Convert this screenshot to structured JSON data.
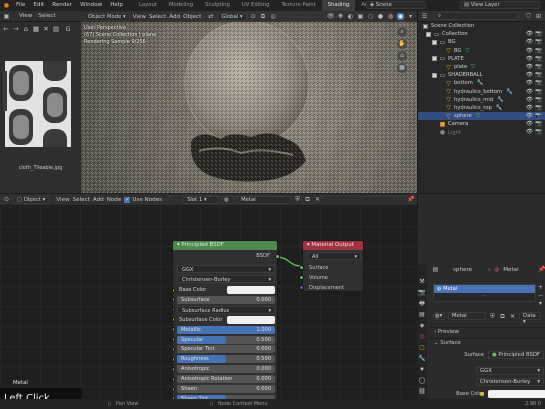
{
  "topbar": {
    "menus": [
      "File",
      "Edit",
      "Render",
      "Window",
      "Help"
    ],
    "workspaces": [
      "Layout",
      "Modeling",
      "Sculpting",
      "UV Editing",
      "Texture Paint",
      "Shading",
      "Animation",
      "Rend"
    ],
    "active_workspace": "Shading",
    "scene": "Scene",
    "view_layer": "View Layer"
  },
  "image_editor": {
    "menus": [
      "View",
      "Select"
    ],
    "image_name": "cloth_Tileable.jpg"
  },
  "viewport": {
    "mode": "Object Mode",
    "menus": [
      "View",
      "Select",
      "Add",
      "Object"
    ],
    "orientation": "Global",
    "info_lines": [
      "User Perspective",
      "(67) Scene Collection | plane",
      "Rendering Sample 9/256"
    ]
  },
  "outliner": {
    "root": "Scene Collection",
    "rows": [
      {
        "label": "Collection",
        "depth": 1,
        "kind": "collection"
      },
      {
        "label": "BG",
        "depth": 2,
        "kind": "collection"
      },
      {
        "label": "BG",
        "depth": 3,
        "kind": "mesh"
      },
      {
        "label": "PLATE",
        "depth": 2,
        "kind": "collection"
      },
      {
        "label": "plate",
        "depth": 3,
        "kind": "mesh"
      },
      {
        "label": "SHADERBALL",
        "depth": 2,
        "kind": "collection"
      },
      {
        "label": "bottom",
        "depth": 3,
        "kind": "mesh"
      },
      {
        "label": "hydraulics_bottom",
        "depth": 3,
        "kind": "mesh"
      },
      {
        "label": "hydraulics_mid",
        "depth": 3,
        "kind": "mesh"
      },
      {
        "label": "hydraulics_top",
        "depth": 3,
        "kind": "mesh"
      },
      {
        "label": "sphere",
        "depth": 3,
        "kind": "mesh",
        "selected": true
      },
      {
        "label": "Camera",
        "depth": 2,
        "kind": "camera"
      },
      {
        "label": "Light",
        "depth": 2,
        "kind": "light",
        "dim": true
      }
    ]
  },
  "node_editor": {
    "mode": "Object",
    "menus": [
      "View",
      "Select",
      "Add",
      "Node"
    ],
    "use_nodes": "Use Nodes",
    "slot": "Slot 1",
    "material": "Metal",
    "material_label": "Metal",
    "principled": {
      "title": "Principled BSDF",
      "output": "BSDF",
      "distribution": "GGX",
      "subsurface_method": "Christensen-Burley",
      "fields": [
        {
          "name": "Base Color",
          "kind": "color",
          "color": "#f0f0f0"
        },
        {
          "name": "Subsurface",
          "value": "0.000",
          "fill": 0
        },
        {
          "name": "Subsurface Radius",
          "kind": "dropdown"
        },
        {
          "name": "Subsurface Color",
          "kind": "color",
          "color": "#f0f0f0"
        },
        {
          "name": "Metallic",
          "value": "1.000",
          "fill": 1
        },
        {
          "name": "Specular",
          "value": "0.500",
          "fill": 0.5
        },
        {
          "name": "Specular Tint",
          "value": "0.000",
          "fill": 0
        },
        {
          "name": "Roughness",
          "value": "0.500",
          "fill": 0.5
        },
        {
          "name": "Anisotropic",
          "value": "0.000",
          "fill": 0
        },
        {
          "name": "Anisotropic Rotation",
          "value": "0.000",
          "fill": 0
        },
        {
          "name": "Sheen",
          "value": "0.000",
          "fill": 0
        },
        {
          "name": "Sheen Tint",
          "value": "",
          "fill": 0.5
        }
      ]
    },
    "material_output": {
      "title": "Material Output",
      "target": "All",
      "inputs": [
        "Surface",
        "Volume",
        "Displacement"
      ]
    }
  },
  "properties": {
    "object": "sphere",
    "material_tab": "Metal",
    "slot_name": "Metal",
    "material_name": "Metal",
    "data_label": "Data",
    "preview": "Preview",
    "surface_section": "Surface",
    "surface_label": "Surface",
    "surface_value": "Principled BSDF",
    "distribution": "GGX",
    "subsurface_method": "Christensen-Burley",
    "base_color_label": "Base Color",
    "base_color": "#f2f2f2"
  },
  "statusbar": {
    "items": [
      "Pan View",
      "Node Context Menu"
    ],
    "version": "2.90.0"
  },
  "overlay": {
    "left_click": "Left Click"
  },
  "colors": {
    "accent": "#4772b3",
    "selection": "#334d80",
    "shader_header": "#4d8a4d",
    "output_header": "#a33240",
    "socket_color": "#c7c729",
    "socket_float": "#a1a1a1",
    "socket_shader": "#5fc35f"
  }
}
